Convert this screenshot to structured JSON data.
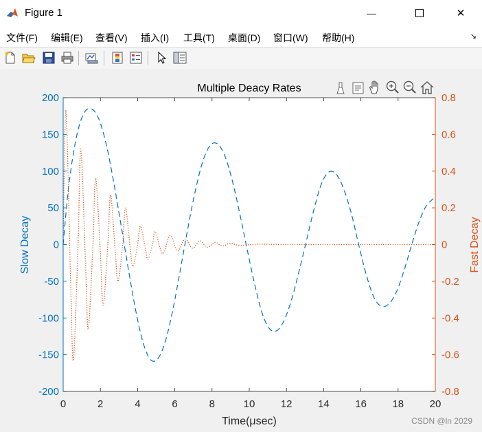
{
  "window": {
    "title": "Figure 1",
    "minimize_glyph": "—",
    "close_glyph": "✕"
  },
  "menu": [
    {
      "label": "文件(F)"
    },
    {
      "label": "编辑(E)"
    },
    {
      "label": "查看(V)"
    },
    {
      "label": "插入(I)"
    },
    {
      "label": "工具(T)"
    },
    {
      "label": "桌面(D)"
    },
    {
      "label": "窗口(W)"
    },
    {
      "label": "帮助(H)"
    }
  ],
  "menu_overflow_glyph": "↘",
  "toolbar": {
    "icons": [
      "new-figure-icon",
      "open-file-icon",
      "save-icon",
      "print-icon",
      "link-plot-icon",
      "insert-colorbar-icon",
      "insert-legend-icon",
      "edit-plot-cursor-icon",
      "property-inspector-icon"
    ]
  },
  "axes_toolbar": {
    "icons": [
      "brush-icon",
      "data-tips-icon",
      "pan-hand-icon",
      "zoom-in-icon",
      "zoom-out-icon",
      "home-icon"
    ]
  },
  "colors": {
    "left": "#0072BD",
    "right": "#D95319"
  },
  "chart_data": {
    "type": "line",
    "title": "Multiple Deacy Rates",
    "xlabel": "Time(μsec)",
    "ylabel_left": "Slow Decay",
    "ylabel_right": "Fast Decay",
    "xlim": [
      0,
      20
    ],
    "ylim_left": [
      -200,
      200
    ],
    "ylim_right": [
      -0.8,
      0.8
    ],
    "xticks": [
      0,
      2,
      4,
      6,
      8,
      10,
      12,
      14,
      16,
      18,
      20
    ],
    "xtick_labels": [
      "0",
      "2",
      "4",
      "6",
      "8",
      "10",
      "12",
      "14",
      "16",
      "18",
      "20"
    ],
    "yticks_left": [
      -200,
      -150,
      -100,
      -50,
      0,
      50,
      100,
      150,
      200
    ],
    "ytick_labels_left": [
      "-200",
      "-150",
      "-100",
      "-50",
      "0",
      "50",
      "100",
      "150",
      "200"
    ],
    "yticks_right": [
      -0.8,
      -0.6,
      -0.4,
      -0.2,
      0,
      0.2,
      0.4,
      0.6,
      0.8
    ],
    "ytick_labels_right": [
      "-0.8",
      "-0.6",
      "-0.4",
      "-0.2",
      "0",
      "0.2",
      "0.4",
      "0.6",
      "0.8"
    ],
    "grid": false,
    "series": [
      {
        "axis": "left",
        "style": "dashed",
        "points": [
          [
            0,
            0
          ],
          [
            0.3,
            80
          ],
          [
            0.7,
            145
          ],
          [
            1.1,
            178
          ],
          [
            1.5,
            185
          ],
          [
            1.9,
            172
          ],
          [
            2.3,
            138
          ],
          [
            2.7,
            87
          ],
          [
            3.1,
            28
          ],
          [
            3.5,
            -33
          ],
          [
            3.9,
            -90
          ],
          [
            4.3,
            -134
          ],
          [
            4.7,
            -157
          ],
          [
            5.1,
            -155
          ],
          [
            5.5,
            -131
          ],
          [
            5.9,
            -88
          ],
          [
            6.3,
            -34
          ],
          [
            6.7,
            22
          ],
          [
            7.1,
            73
          ],
          [
            7.5,
            113
          ],
          [
            7.9,
            135
          ],
          [
            8.3,
            137
          ],
          [
            8.7,
            120
          ],
          [
            9.1,
            86
          ],
          [
            9.5,
            41
          ],
          [
            9.9,
            -8
          ],
          [
            10.3,
            -55
          ],
          [
            10.7,
            -94
          ],
          [
            11.1,
            -115
          ],
          [
            11.5,
            -117
          ],
          [
            11.9,
            -102
          ],
          [
            12.3,
            -73
          ],
          [
            12.7,
            -34
          ],
          [
            13.1,
            8
          ],
          [
            13.5,
            50
          ],
          [
            13.9,
            84
          ],
          [
            14.3,
            99
          ],
          [
            14.7,
            95
          ],
          [
            15.1,
            74
          ],
          [
            15.5,
            41
          ],
          [
            15.9,
            -2
          ],
          [
            16.3,
            -42
          ],
          [
            16.7,
            -72
          ],
          [
            17.1,
            -84
          ],
          [
            17.5,
            -81
          ],
          [
            17.9,
            -65
          ],
          [
            18.3,
            -37
          ],
          [
            18.7,
            -3
          ],
          [
            19.1,
            29
          ],
          [
            19.5,
            52
          ],
          [
            20,
            65
          ]
        ]
      },
      {
        "axis": "right",
        "style": "dotted",
        "points": [
          [
            0,
            0
          ],
          [
            0.15,
            0.73
          ],
          [
            0.4,
            -0.2
          ],
          [
            0.55,
            -0.63
          ],
          [
            0.8,
            0.0
          ],
          [
            0.95,
            0.52
          ],
          [
            1.2,
            -0.1
          ],
          [
            1.35,
            -0.46
          ],
          [
            1.6,
            0.0
          ],
          [
            1.75,
            0.36
          ],
          [
            2.0,
            -0.05
          ],
          [
            2.15,
            -0.33
          ],
          [
            2.4,
            0.0
          ],
          [
            2.55,
            0.27
          ],
          [
            2.8,
            -0.04
          ],
          [
            2.95,
            -0.2
          ],
          [
            3.2,
            0.0
          ],
          [
            3.35,
            0.2
          ],
          [
            3.6,
            -0.02
          ],
          [
            3.75,
            -0.12
          ],
          [
            4.0,
            0.0
          ],
          [
            4.15,
            0.1
          ],
          [
            4.4,
            -0.01
          ],
          [
            4.55,
            -0.08
          ],
          [
            4.8,
            0.0
          ],
          [
            4.95,
            0.07
          ],
          [
            5.35,
            -0.05
          ],
          [
            5.75,
            0.05
          ],
          [
            6.15,
            -0.035
          ],
          [
            6.55,
            0.03
          ],
          [
            6.95,
            -0.02
          ],
          [
            7.35,
            0.02
          ],
          [
            7.75,
            -0.015
          ],
          [
            8.15,
            0.012
          ],
          [
            8.55,
            -0.008
          ],
          [
            8.95,
            0.006
          ],
          [
            9.5,
            -0.004
          ],
          [
            10.5,
            0.002
          ],
          [
            12,
            0
          ],
          [
            16,
            0
          ],
          [
            20,
            0
          ]
        ]
      }
    ]
  },
  "watermark": "CSDN @ln 2029"
}
